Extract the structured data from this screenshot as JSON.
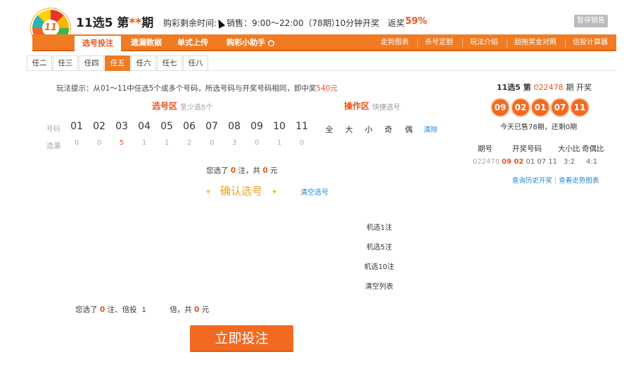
{
  "header": {
    "logo_text": "11",
    "title_prefix": "11选5 第",
    "title_stars": "**",
    "title_suffix": "期",
    "countdown_label": "购彩剩余时间:",
    "sales_label": "销售：9:00～22:00（78期）",
    "draw_interval": "10分钟开奖",
    "rate_label": "返奖",
    "rate_value": "59%",
    "pause_label": "暂停销售"
  },
  "nav": {
    "left": [
      "选号投注",
      "遗漏数据",
      "单式上传",
      "购彩小助手"
    ],
    "right": [
      "走势图表",
      "杀号定胆",
      "玩法介绍",
      "胆拖奖金对照",
      "倍投计算器"
    ]
  },
  "subtabs": [
    "任二",
    "任三",
    "任四",
    "任五",
    "任六",
    "任七",
    "任八"
  ],
  "tip": {
    "prefix": "玩法提示：从01～11中任选5个或多个号码，所选号码与开奖号码相同，即中奖",
    "prize": "540元"
  },
  "select": {
    "heading": "选号区",
    "sub": "至少选5个",
    "op_heading": "操作区",
    "op_sub": "快捷选号",
    "row_label_num": "号码",
    "row_label_miss": "遗漏",
    "numbers": [
      "01",
      "02",
      "03",
      "04",
      "05",
      "06",
      "07",
      "08",
      "09",
      "10",
      "11"
    ],
    "missing": [
      "0",
      "0",
      "5",
      "1",
      "1",
      "2",
      "0",
      "3",
      "0",
      "1",
      "0"
    ],
    "ops": [
      "全",
      "大",
      "小",
      "奇",
      "偶"
    ],
    "clear": "清除"
  },
  "summary": {
    "t1": "您选了",
    "count": "0",
    "t2": "注，共",
    "amount": "0",
    "t3": "元"
  },
  "confirm_label": "确认选号",
  "clear_select_label": "清空选号",
  "random": [
    "机选1注",
    "机选5注",
    "机选10注",
    "清空列表"
  ],
  "bottom": {
    "t1": "您选了",
    "count": "0",
    "t2": "注、倍投",
    "multiple": "1",
    "t3": "倍，共",
    "amount": "0",
    "t4": "元"
  },
  "bet_button": "立即投注",
  "draw": {
    "title_prefix": "11选5 第",
    "issue": "022478",
    "title_suffix": "期 开奖",
    "balls": [
      "09",
      "02",
      "01",
      "07",
      "11"
    ],
    "note": "今天已售78期，还剩0期",
    "headers": [
      "期号",
      "开奖号码",
      "大小比",
      "奇偶比"
    ],
    "row": {
      "issue": "022478",
      "nums_hl": "09 02",
      "nums_rest": "01 07 11",
      "size_ratio": "3:2",
      "odd_even": "4:1"
    },
    "link_history": "查询历史开奖",
    "link_trend": "查看走势图表"
  }
}
